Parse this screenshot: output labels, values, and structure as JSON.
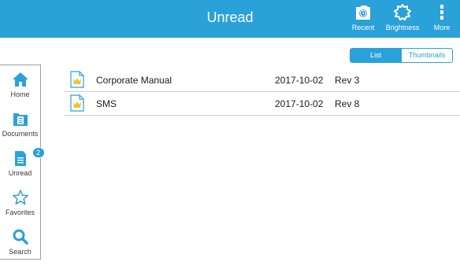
{
  "header": {
    "title": "Unread",
    "buttons": [
      {
        "label": "Recent",
        "icon": "recent-clock-icon"
      },
      {
        "label": "Brightness",
        "icon": "brightness-gear-icon"
      },
      {
        "label": "More",
        "icon": "more-dots-icon"
      }
    ]
  },
  "sidebar": {
    "items": [
      {
        "label": "Home",
        "icon": "home-icon"
      },
      {
        "label": "Documents",
        "icon": "documents-icon"
      },
      {
        "label": "Unread",
        "icon": "unread-document-icon",
        "badge": "2"
      },
      {
        "label": "Favorites",
        "icon": "star-icon"
      },
      {
        "label": "Search",
        "icon": "search-icon"
      }
    ]
  },
  "view_toggle": {
    "options": [
      "List",
      "Thumbnails"
    ],
    "selected": "List"
  },
  "documents": [
    {
      "name": "Corporate Manual",
      "date": "2017-10-02",
      "revision": "Rev 3",
      "icon": "document-crown-icon"
    },
    {
      "name": "SMS",
      "date": "2017-10-02",
      "revision": "Rev 8",
      "icon": "document-crown-icon"
    }
  ],
  "colors": {
    "accent": "#2aa1d8",
    "header_background": "#2aa1d8",
    "icon_crown": "#f0c431"
  }
}
